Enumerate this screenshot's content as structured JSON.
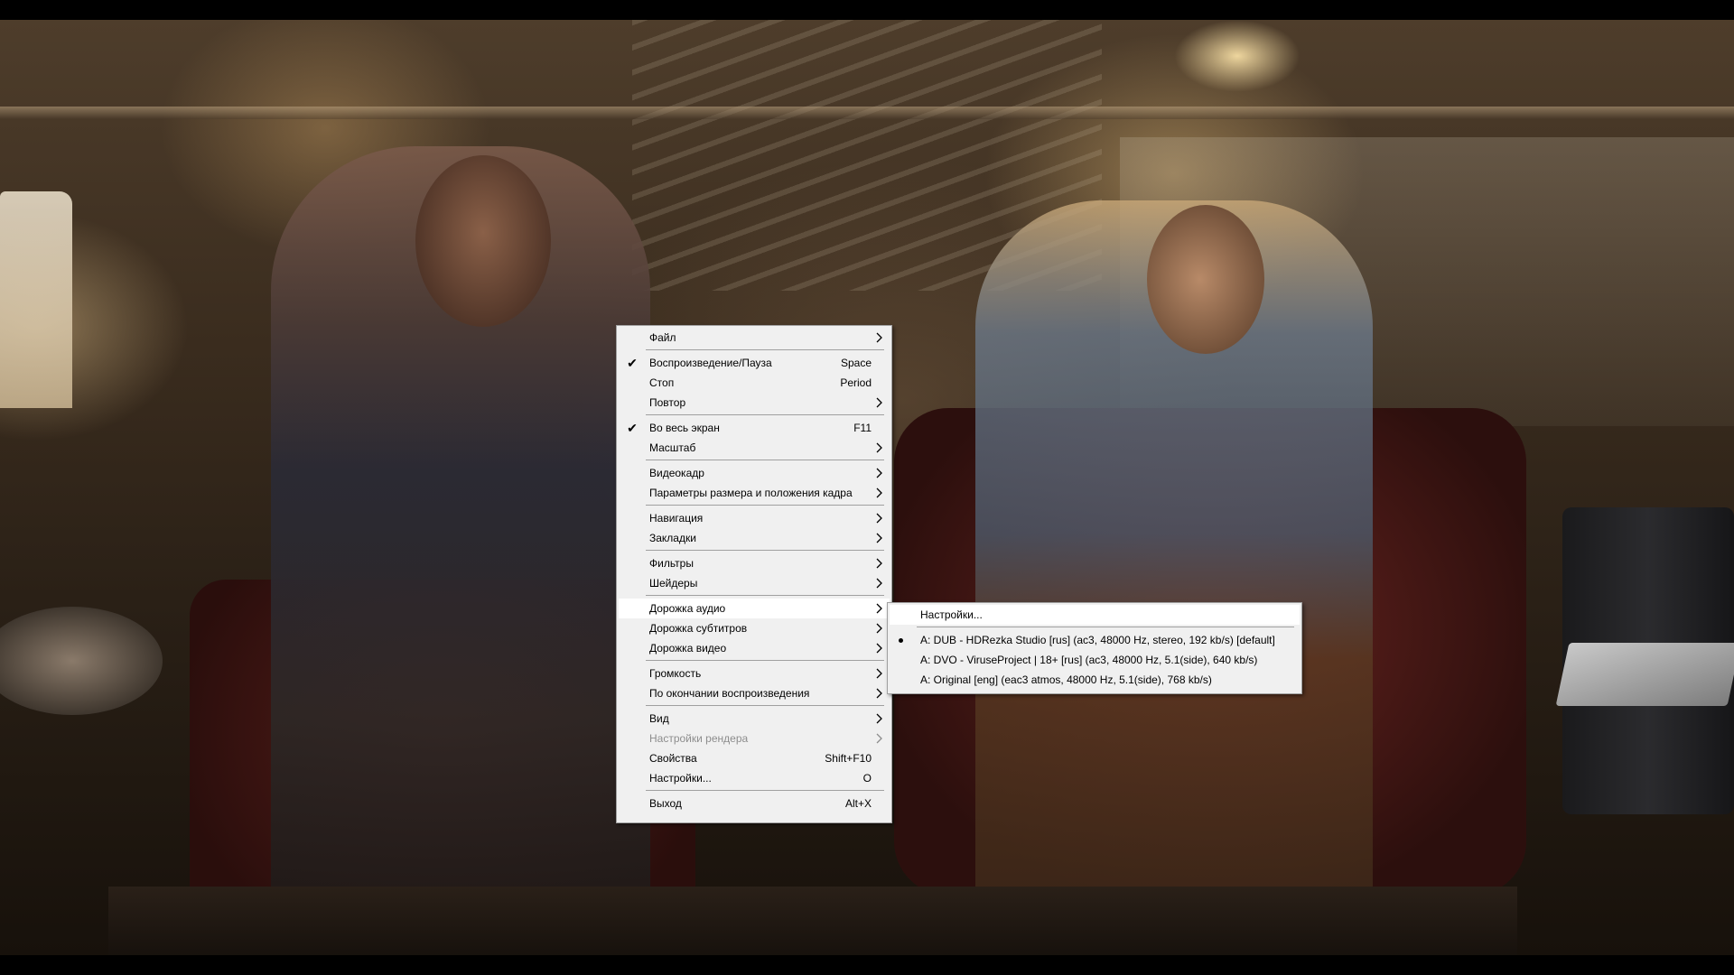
{
  "menu": {
    "items": [
      {
        "label": "Файл",
        "check": "",
        "shortcut": "",
        "submenu": true
      },
      {
        "label": "Воспроизведение/Пауза",
        "check": "✔",
        "shortcut": "Space",
        "submenu": false
      },
      {
        "label": "Стоп",
        "check": "",
        "shortcut": "Period",
        "submenu": false
      },
      {
        "label": "Повтор",
        "check": "",
        "shortcut": "",
        "submenu": true
      },
      {
        "label": "Во весь экран",
        "check": "✔",
        "shortcut": "F11",
        "submenu": false
      },
      {
        "label": "Масштаб",
        "check": "",
        "shortcut": "",
        "submenu": true
      },
      {
        "label": "Видеокадр",
        "check": "",
        "shortcut": "",
        "submenu": true
      },
      {
        "label": "Параметры размера и положения кадра",
        "check": "",
        "shortcut": "",
        "submenu": true
      },
      {
        "label": "Навигация",
        "check": "",
        "shortcut": "",
        "submenu": true
      },
      {
        "label": "Закладки",
        "check": "",
        "shortcut": "",
        "submenu": true
      },
      {
        "label": "Фильтры",
        "check": "",
        "shortcut": "",
        "submenu": true
      },
      {
        "label": "Шейдеры",
        "check": "",
        "shortcut": "",
        "submenu": true
      },
      {
        "label": "Дорожка аудио",
        "check": "",
        "shortcut": "",
        "submenu": true,
        "highlighted": true
      },
      {
        "label": "Дорожка субтитров",
        "check": "",
        "shortcut": "",
        "submenu": true
      },
      {
        "label": "Дорожка видео",
        "check": "",
        "shortcut": "",
        "submenu": true
      },
      {
        "label": "Громкость",
        "check": "",
        "shortcut": "",
        "submenu": true
      },
      {
        "label": "По окончании воспроизведения",
        "check": "",
        "shortcut": "",
        "submenu": true
      },
      {
        "label": "Вид",
        "check": "",
        "shortcut": "",
        "submenu": true
      },
      {
        "label": "Настройки рендера",
        "check": "",
        "shortcut": "",
        "submenu": true,
        "disabled": true
      },
      {
        "label": "Свойства",
        "check": "",
        "shortcut": "Shift+F10",
        "submenu": false
      },
      {
        "label": "Настройки...",
        "check": "",
        "shortcut": "O",
        "submenu": false
      },
      {
        "label": "Выход",
        "check": "",
        "shortcut": "Alt+X",
        "submenu": false
      }
    ]
  },
  "audio_submenu": {
    "settings_label": "Настройки...",
    "tracks": [
      {
        "label": "A: DUB - HDRezka Studio [rus] (ac3, 48000 Hz, stereo, 192 kb/s) [default]",
        "selected": true
      },
      {
        "label": "A: DVO - ViruseProject | 18+ [rus] (ac3, 48000 Hz, 5.1(side), 640 kb/s)",
        "selected": false
      },
      {
        "label": "A: Original [eng] (eac3 atmos, 48000 Hz, 5.1(side), 768 kb/s)",
        "selected": false
      }
    ]
  },
  "colors": {
    "menu_background": "#f0f0f0",
    "menu_border": "#a0a0a0",
    "highlight": "#ffffff",
    "disabled_text": "#8d8d8d"
  },
  "icons": {
    "check": "check-icon",
    "submenu_arrow": "chevron-right-icon",
    "radio_bullet": "radio-bullet-icon"
  }
}
